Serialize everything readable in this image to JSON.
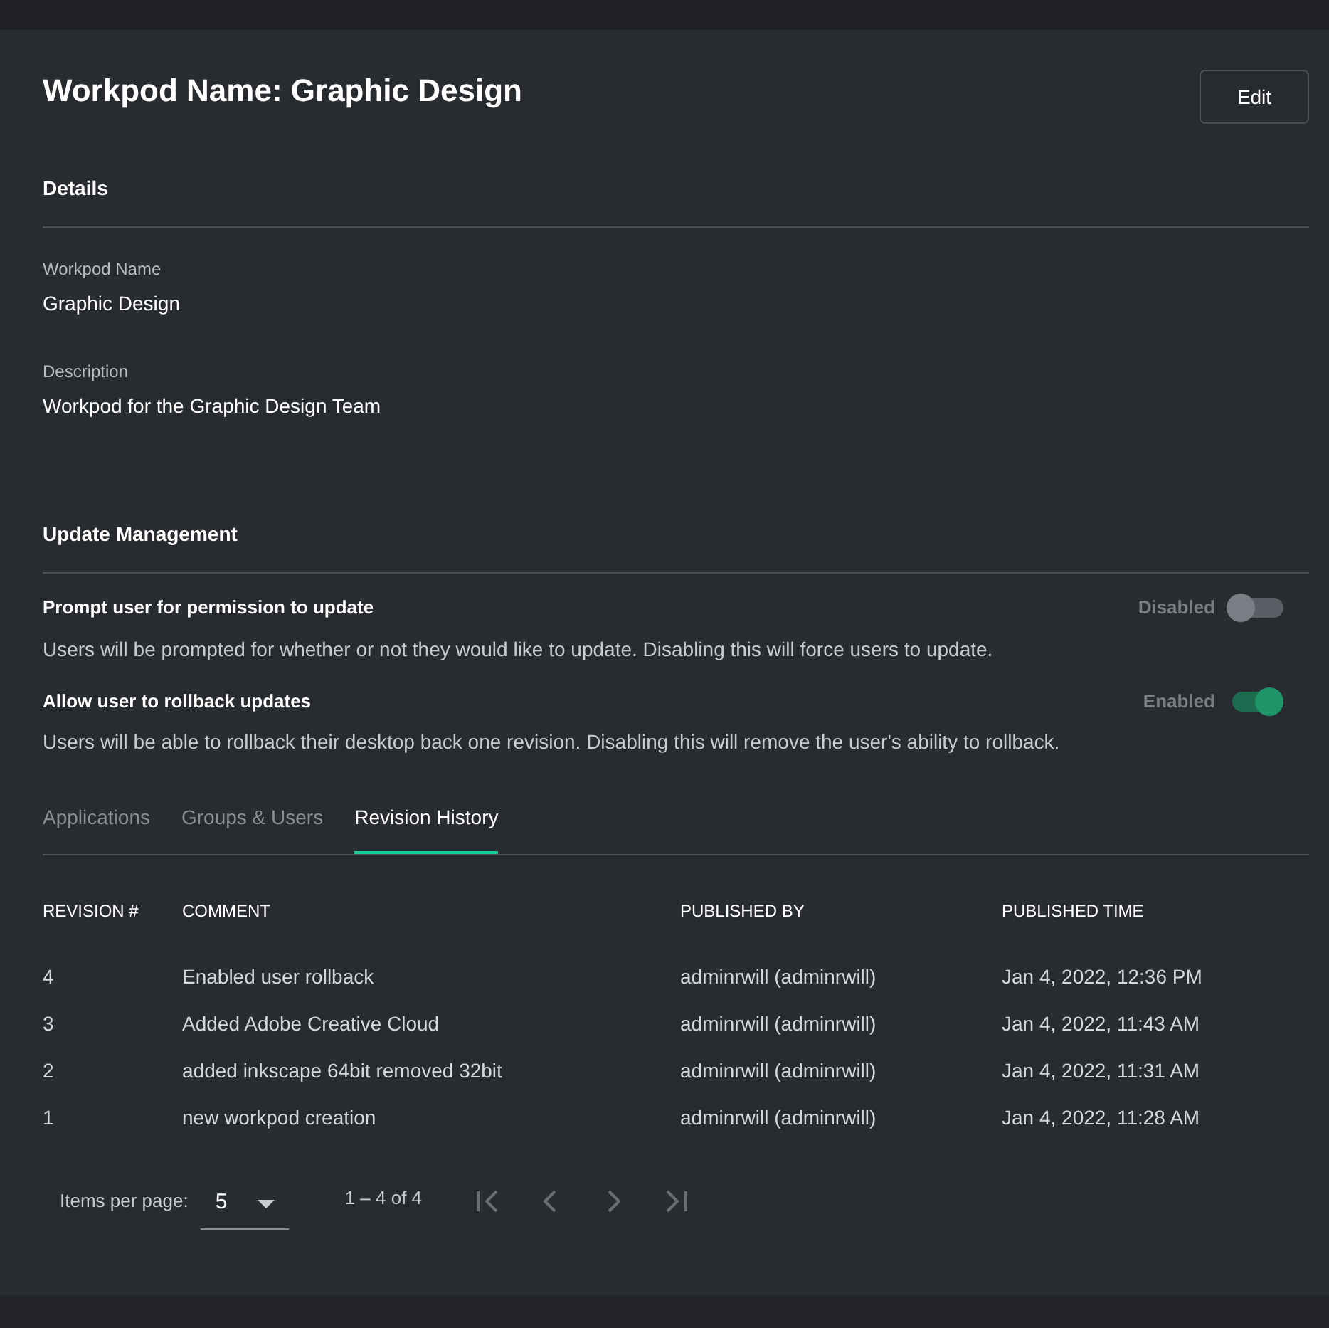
{
  "header": {
    "title": "Workpod Name: Graphic Design",
    "edit_button": "Edit"
  },
  "details": {
    "heading": "Details",
    "fields": [
      {
        "label": "Workpod Name",
        "value": "Graphic Design"
      },
      {
        "label": "Description",
        "value": "Workpod for the Graphic Design Team"
      }
    ]
  },
  "update_management": {
    "heading": "Update Management",
    "settings": [
      {
        "title": "Prompt user for permission to update",
        "description": "Users will be prompted for whether or not they would like to update. Disabling this will force users to update.",
        "state_label": "Disabled",
        "on": false
      },
      {
        "title": "Allow user to rollback updates",
        "description": "Users will be able to rollback their desktop back one revision. Disabling this will remove the user's ability to rollback.",
        "state_label": "Enabled",
        "on": true
      }
    ]
  },
  "tabs": [
    {
      "label": "Applications",
      "selected": false
    },
    {
      "label": "Groups & Users",
      "selected": false
    },
    {
      "label": "Revision History",
      "selected": true
    }
  ],
  "table": {
    "columns": [
      "REVISION #",
      "COMMENT",
      "PUBLISHED BY",
      "PUBLISHED TIME"
    ],
    "rows": [
      [
        "4",
        "Enabled user rollback",
        "adminrwill (adminrwill)",
        "Jan 4, 2022, 12:36 PM"
      ],
      [
        "3",
        "Added Adobe Creative Cloud",
        "adminrwill (adminrwill)",
        "Jan 4, 2022, 11:43 AM"
      ],
      [
        "2",
        "added inkscape 64bit removed 32bit",
        "adminrwill (adminrwill)",
        "Jan 4, 2022, 11:31 AM"
      ],
      [
        "1",
        "new workpod creation",
        "adminrwill (adminrwill)",
        "Jan 4, 2022, 11:28 AM"
      ]
    ]
  },
  "paginator": {
    "items_label": "Items per page:",
    "page_size": "5",
    "range": "1 – 4 of 4",
    "buttons": [
      {
        "kind": "first",
        "disabled": true
      },
      {
        "kind": "previous",
        "disabled": true
      },
      {
        "kind": "next",
        "disabled": true
      },
      {
        "kind": "last",
        "disabled": true
      }
    ]
  }
}
